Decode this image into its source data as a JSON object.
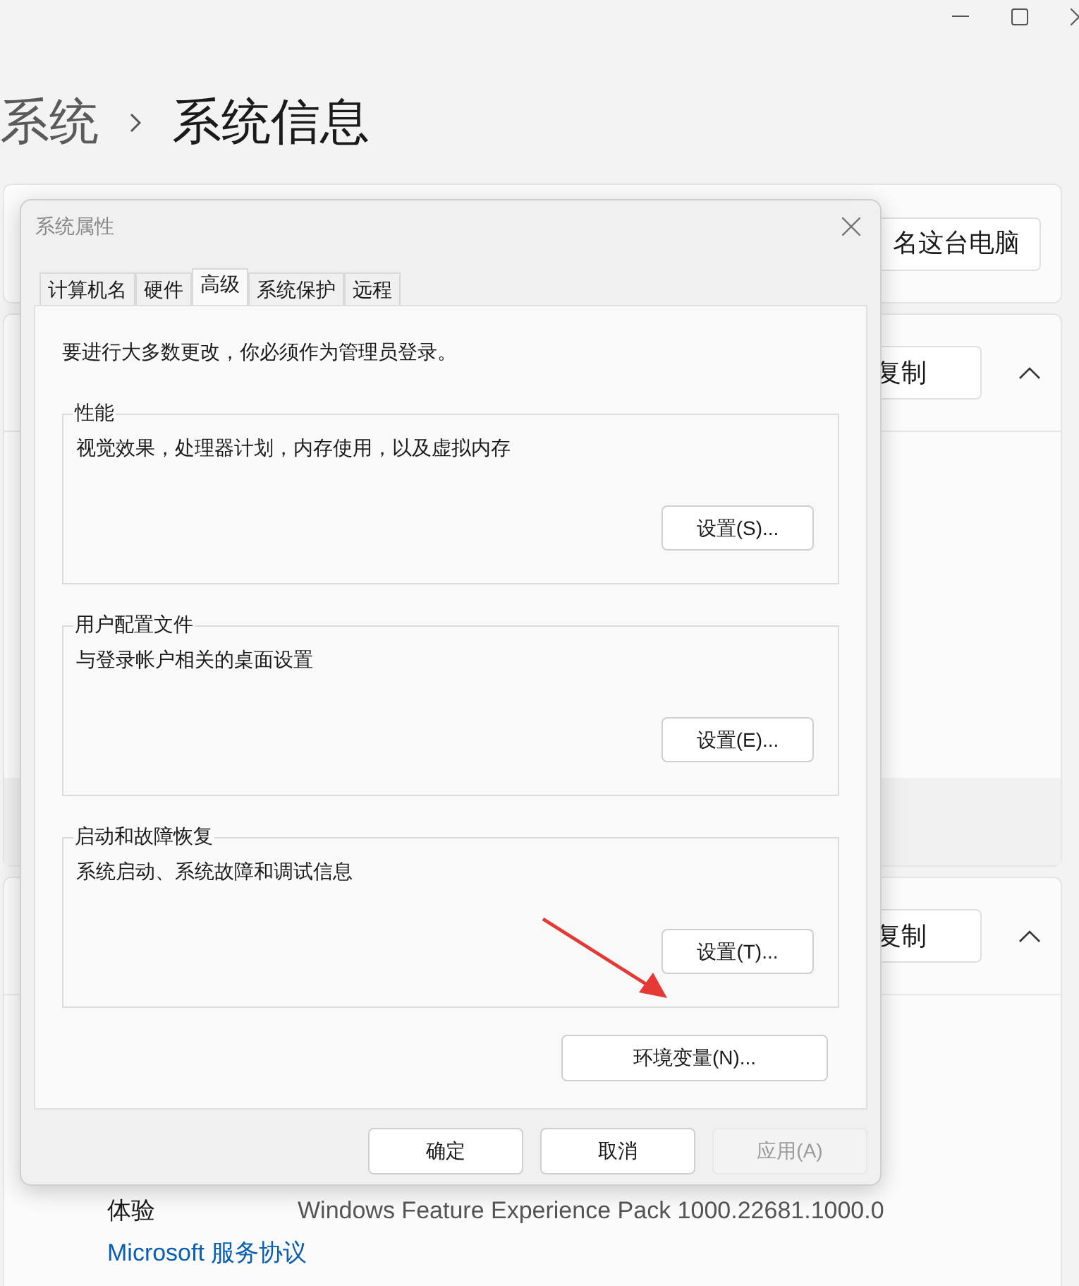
{
  "breadcrumb": {
    "parent": "系统",
    "current": "系统信息"
  },
  "rename_button": "名这台电脑",
  "sections": [
    {
      "copy_button": "复制",
      "expanded": true
    },
    {
      "copy_button": "复制",
      "expanded": true
    }
  ],
  "info_rows": [
    {
      "label": "体验",
      "value": "Windows Feature Experience Pack 1000.22681.1000.0"
    }
  ],
  "link": "Microsoft 服务协议",
  "dialog": {
    "title": "系统属性",
    "tabs": [
      {
        "label": "计算机名",
        "selected": false
      },
      {
        "label": "硬件",
        "selected": false
      },
      {
        "label": "高级",
        "selected": true
      },
      {
        "label": "系统保护",
        "selected": false
      },
      {
        "label": "远程",
        "selected": false
      }
    ],
    "notice": "要进行大多数更改，你必须作为管理员登录。",
    "groups": [
      {
        "title": "性能",
        "description": "视觉效果，处理器计划，内存使用，以及虚拟内存",
        "button": "设置(S)..."
      },
      {
        "title": "用户配置文件",
        "description": "与登录帐户相关的桌面设置",
        "button": "设置(E)..."
      },
      {
        "title": "启动和故障恢复",
        "description": "系统启动、系统故障和调试信息",
        "button": "设置(T)..."
      }
    ],
    "env_button": "环境变量(N)...",
    "buttons": [
      {
        "label": "确定",
        "disabled": false
      },
      {
        "label": "取消",
        "disabled": false
      },
      {
        "label": "应用(A)",
        "disabled": true
      }
    ]
  }
}
